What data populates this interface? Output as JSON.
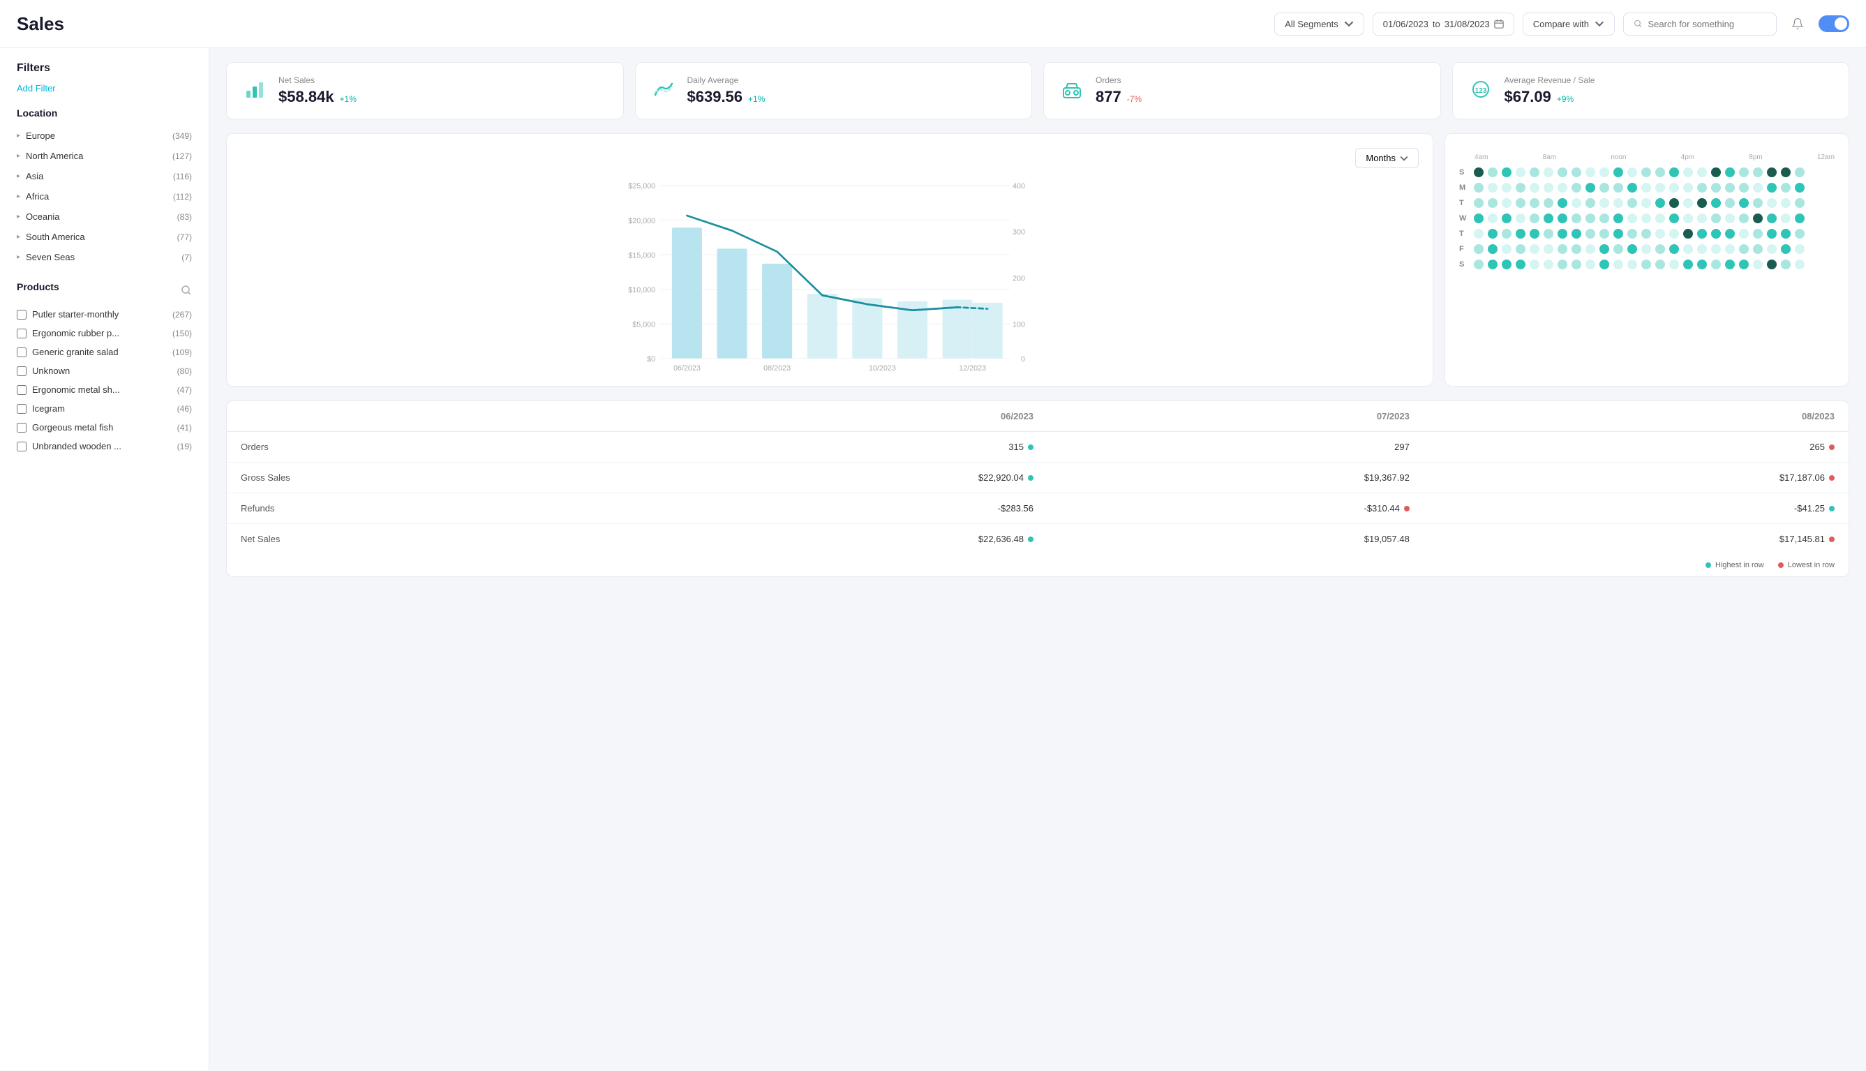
{
  "header": {
    "title": "Sales",
    "segment_label": "All Segments",
    "date_from": "01/06/2023",
    "date_to": "31/08/2023",
    "compare_label": "Compare with",
    "search_placeholder": "Search for something"
  },
  "filters": {
    "title": "Filters",
    "add_filter_label": "Add Filter"
  },
  "location": {
    "title": "Location",
    "items": [
      {
        "name": "Europe",
        "count": "(349)"
      },
      {
        "name": "North America",
        "count": "(127)"
      },
      {
        "name": "Asia",
        "count": "(116)"
      },
      {
        "name": "Africa",
        "count": "(112)"
      },
      {
        "name": "Oceania",
        "count": "(83)"
      },
      {
        "name": "South America",
        "count": "(77)"
      },
      {
        "name": "Seven Seas",
        "count": "(7)"
      }
    ]
  },
  "products": {
    "title": "Products",
    "items": [
      {
        "name": "Putler starter-monthly",
        "count": "(267)",
        "checked": false
      },
      {
        "name": "Ergonomic rubber p...",
        "count": "(150)",
        "checked": false
      },
      {
        "name": "Generic granite salad",
        "count": "(109)",
        "checked": false
      },
      {
        "name": "Unknown",
        "count": "(80)",
        "checked": false
      },
      {
        "name": "Ergonomic metal sh...",
        "count": "(47)",
        "checked": false
      },
      {
        "name": "Icegram",
        "count": "(46)",
        "checked": false
      },
      {
        "name": "Gorgeous metal fish",
        "count": "(41)",
        "checked": false
      },
      {
        "name": "Unbranded wooden ...",
        "count": "(19)",
        "checked": false
      }
    ]
  },
  "kpi": {
    "cards": [
      {
        "label": "Net Sales",
        "value": "$58.84k",
        "change": "+1%",
        "positive": true
      },
      {
        "label": "Daily Average",
        "value": "$639.56",
        "change": "+1%",
        "positive": true
      },
      {
        "label": "Orders",
        "value": "877",
        "change": "-7%",
        "positive": false
      },
      {
        "label": "Average Revenue / Sale",
        "value": "$67.09",
        "change": "+9%",
        "positive": true
      }
    ]
  },
  "chart": {
    "months_label": "Months",
    "y_labels": [
      "$25,000",
      "$20,000",
      "$15,000",
      "$10,000",
      "$5,000",
      "$0"
    ],
    "y_labels_right": [
      "400",
      "300",
      "200",
      "100",
      "0"
    ],
    "x_labels": [
      "06/2023",
      "08/2023",
      "10/2023",
      "12/2023"
    ]
  },
  "dot_grid": {
    "time_labels": [
      "4am",
      "8am",
      "noon",
      "4pm",
      "8pm",
      "12am"
    ],
    "days": [
      "S",
      "M",
      "T",
      "W",
      "T",
      "F",
      "S"
    ]
  },
  "table": {
    "columns": [
      "",
      "06/2023",
      "07/2023",
      "08/2023"
    ],
    "rows": [
      {
        "label": "Orders",
        "values": [
          {
            "text": "315",
            "dot": "green"
          },
          {
            "text": "297",
            "dot": null
          },
          {
            "text": "265",
            "dot": "red"
          }
        ]
      },
      {
        "label": "Gross Sales",
        "values": [
          {
            "text": "$22,920.04",
            "dot": "green"
          },
          {
            "text": "$19,367.92",
            "dot": null
          },
          {
            "text": "$17,187.06",
            "dot": "red"
          }
        ]
      },
      {
        "label": "Refunds",
        "values": [
          {
            "text": "-$283.56",
            "dot": null
          },
          {
            "text": "-$310.44",
            "dot": "red"
          },
          {
            "text": "-$41.25",
            "dot": "green"
          }
        ]
      },
      {
        "label": "Net Sales",
        "values": [
          {
            "text": "$22,636.48",
            "dot": "green"
          },
          {
            "text": "$19,057.48",
            "dot": null
          },
          {
            "text": "$17,145.81",
            "dot": "red"
          }
        ]
      }
    ],
    "legend_highest": "Highest in row",
    "legend_lowest": "Lowest in row"
  }
}
